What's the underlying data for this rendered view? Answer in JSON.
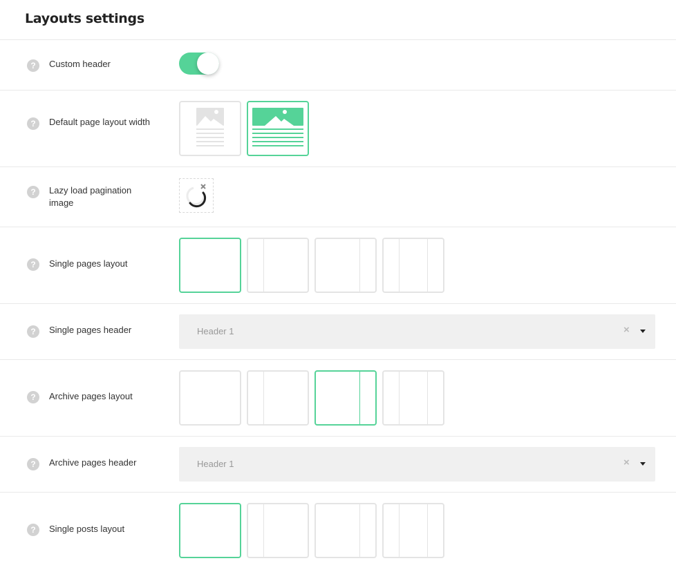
{
  "page": {
    "title": "Layouts settings"
  },
  "colors": {
    "accent": "#55d398",
    "border": "#e4e4e4",
    "help_icon": "#d2d2d2"
  },
  "help_icon_glyph": "?",
  "rows": {
    "custom_header": {
      "label": "Custom header",
      "toggle_on": true
    },
    "default_width": {
      "label": "Default page layout width",
      "options": [
        "boxed",
        "full-width"
      ],
      "selected": 1
    },
    "lazy_load": {
      "label": "Lazy load pagination image"
    },
    "single_pages_layout": {
      "label": "Single pages layout",
      "options": [
        "no-sidebar",
        "left-sidebar",
        "right-sidebar",
        "both-sidebars"
      ],
      "selected": 0
    },
    "single_pages_header": {
      "label": "Single pages header",
      "value": "Header 1",
      "clear": "×"
    },
    "archive_pages_layout": {
      "label": "Archive pages layout",
      "options": [
        "no-sidebar",
        "left-sidebar",
        "right-sidebar",
        "both-sidebars"
      ],
      "selected": 2
    },
    "archive_pages_header": {
      "label": "Archive pages header",
      "value": "Header 1",
      "clear": "×"
    },
    "single_posts_layout": {
      "label": "Single posts layout",
      "options": [
        "no-sidebar",
        "left-sidebar",
        "right-sidebar",
        "both-sidebars"
      ],
      "selected": 0
    }
  }
}
